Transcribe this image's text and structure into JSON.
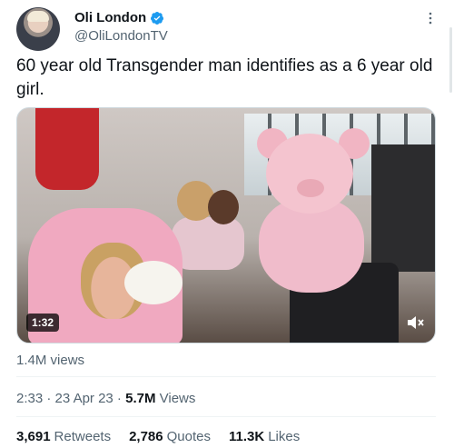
{
  "author": {
    "display_name": "Oli London",
    "handle": "@OliLondonTV",
    "verified": true,
    "verified_color": "#1d9bf0"
  },
  "tweet": {
    "text": "60 year old Transgender man identifies as a 6 year old girl."
  },
  "media": {
    "type": "video",
    "duration": "1:32",
    "view_count": "1.4M views",
    "icons": [
      "mute-icon"
    ]
  },
  "meta": {
    "time": "2:33",
    "separator": " · ",
    "date": "23 Apr 23",
    "views_count": "5.7M",
    "views_label": " Views"
  },
  "stats": {
    "retweets_count": "3,691",
    "retweets_label": "Retweets",
    "quotes_count": "2,786",
    "quotes_label": "Quotes",
    "likes_count": "11.3K",
    "likes_label": "Likes"
  },
  "icons": {
    "verified": "verified-badge-icon",
    "more": "more-options-icon",
    "mute": "mute-icon"
  },
  "colors": {
    "text_primary": "#0f1419",
    "text_secondary": "#536471",
    "accent": "#1d9bf0"
  }
}
